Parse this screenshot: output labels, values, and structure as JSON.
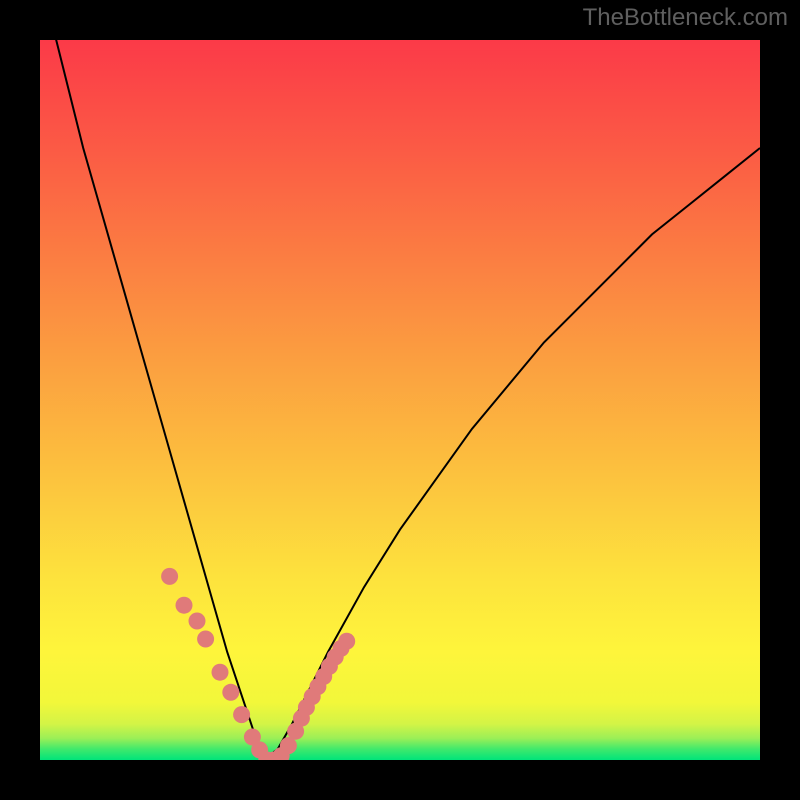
{
  "watermark": "TheBottleneck.com",
  "colors": {
    "frame": "#000000",
    "curve_stroke": "#000000",
    "marker_fill": "#e07a7a",
    "marker_stroke": "#c96262"
  },
  "chart_data": {
    "type": "line",
    "title": "",
    "xlabel": "",
    "ylabel": "",
    "xlim": [
      0,
      100
    ],
    "ylim": [
      0,
      100
    ],
    "grid": false,
    "legend": false,
    "note": "No numeric axes shown on image; x and y normalized to 0-100. Curve shows a V-shape whose minimum hits y=0 near x≈31.",
    "series": [
      {
        "name": "curve",
        "x": [
          0,
          2,
          4,
          6,
          8,
          10,
          12,
          14,
          16,
          18,
          20,
          22,
          24,
          26,
          28,
          30,
          31,
          33,
          35,
          37,
          40,
          45,
          50,
          55,
          60,
          65,
          70,
          75,
          80,
          85,
          90,
          95,
          100
        ],
        "y": [
          110,
          101,
          93,
          85,
          78,
          71,
          64,
          57,
          50,
          43,
          36,
          29,
          22,
          15,
          9,
          3,
          0,
          1.5,
          5,
          9,
          15,
          24,
          32,
          39,
          46,
          52,
          58,
          63,
          68,
          73,
          77,
          81,
          85
        ]
      },
      {
        "name": "markers",
        "x": [
          18,
          20,
          21.8,
          23,
          25,
          26.5,
          28,
          29.5,
          30.5,
          31.5,
          32.5,
          33.5,
          34.5,
          35.5,
          36.3,
          37.0,
          37.8,
          38.6,
          39.4,
          40.2,
          41.0,
          41.8,
          42.6
        ],
        "y": [
          25.5,
          21.5,
          19.3,
          16.8,
          12.2,
          9.4,
          6.3,
          3.2,
          1.4,
          0.0,
          0.0,
          0.6,
          2.0,
          4.0,
          5.8,
          7.3,
          8.8,
          10.2,
          11.6,
          13.0,
          14.3,
          15.5,
          16.5
        ]
      }
    ]
  }
}
